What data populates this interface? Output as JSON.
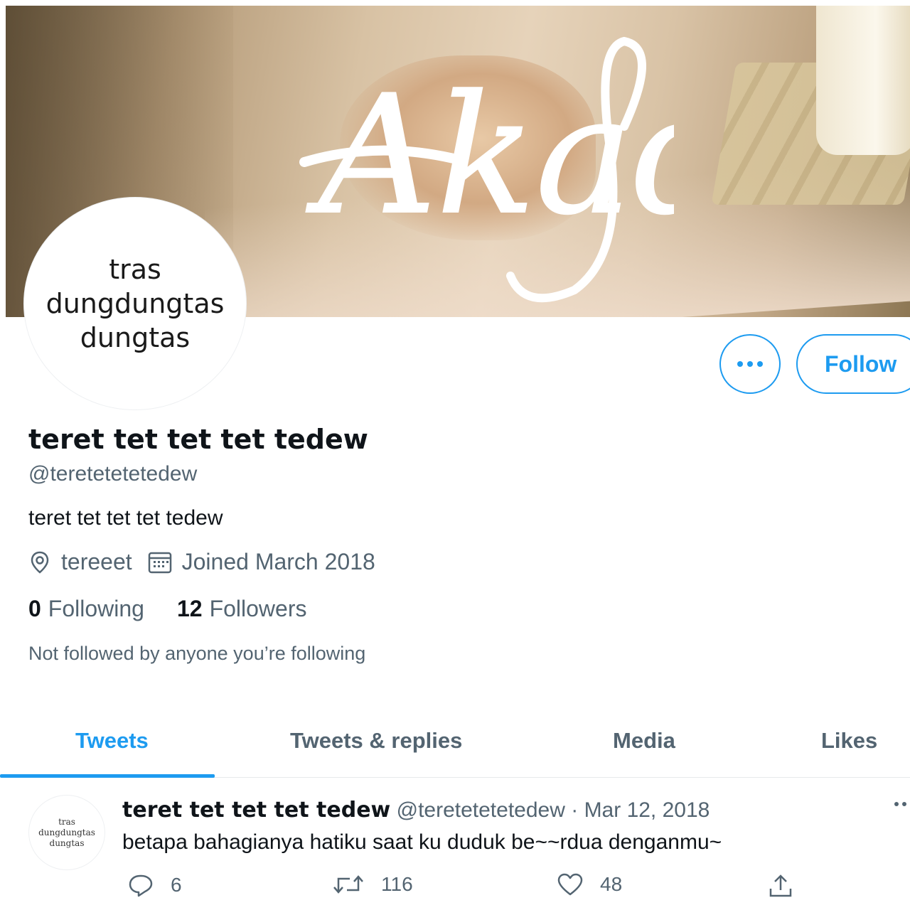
{
  "banner": {
    "logo_text": "Akad"
  },
  "profile": {
    "avatar_lines": [
      "tras",
      "dungdungtas",
      "dungtas"
    ],
    "display_name": "teret tet tet tet tedew",
    "handle": "@teretetetetedew",
    "bio": "teret tet tet tet tedew",
    "location": "tereeet",
    "joined": "Joined March 2018",
    "following_count": "0",
    "following_label": "Following",
    "followers_count": "12",
    "followers_label": "Followers",
    "not_followed_text": "Not followed by anyone you’re following"
  },
  "buttons": {
    "follow_label": "Follow",
    "more_icon": "more-icon"
  },
  "tabs": [
    {
      "label": "Tweets",
      "active": true
    },
    {
      "label": "Tweets & replies",
      "active": false
    },
    {
      "label": "Media",
      "active": false
    },
    {
      "label": "Likes",
      "active": false
    }
  ],
  "tweet": {
    "author_name": "teret tet tet tet tedew",
    "author_handle": "@teretetetetedew",
    "separator": "·",
    "date": "Mar 12, 2018",
    "text": "betapa bahagianya hatiku saat ku duduk be~~rdua denganmu~",
    "replies": "6",
    "retweets": "116",
    "likes": "48"
  },
  "colors": {
    "accent": "#1d9bf0",
    "secondary_text": "#536471",
    "primary_text": "#0f1419"
  }
}
